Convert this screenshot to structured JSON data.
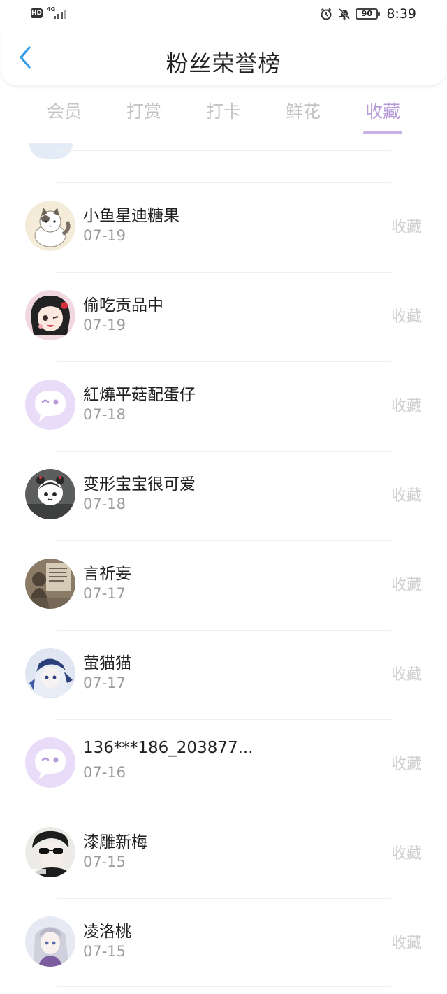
{
  "status_bar": {
    "hd": "HD",
    "network": "4G",
    "battery": "90",
    "time": "8:39"
  },
  "header": {
    "title": "粉丝荣誉榜"
  },
  "tabs": [
    {
      "label": "会员"
    },
    {
      "label": "打赏"
    },
    {
      "label": "打卡"
    },
    {
      "label": "鲜花"
    },
    {
      "label": "收藏"
    }
  ],
  "active_tab": "收藏",
  "accent_color": "#b79ad8",
  "rows": [
    {
      "name": "小鱼星迪糖果",
      "date": "07-19",
      "action": "收藏",
      "avatar": "cat-avatar"
    },
    {
      "name": "偷吃贡品中",
      "date": "07-19",
      "action": "收藏",
      "avatar": "anime-girl-avatar"
    },
    {
      "name": "紅燒平菇配蛋仔",
      "date": "07-18",
      "action": "收藏",
      "avatar": "default-chat-avatar"
    },
    {
      "name": "变形宝宝很可爱",
      "date": "07-18",
      "action": "收藏",
      "avatar": "panda-avatar"
    },
    {
      "name": "言祈妄",
      "date": "07-17",
      "action": "收藏",
      "avatar": "photo-avatar"
    },
    {
      "name": "萤猫猫",
      "date": "07-17",
      "action": "收藏",
      "avatar": "anime-blue-avatar"
    },
    {
      "name": "136***186_203877...",
      "date": "07-16",
      "action": "收藏",
      "avatar": "default-chat-avatar"
    },
    {
      "name": "漆雕新梅",
      "date": "07-15",
      "action": "收藏",
      "avatar": "sunglasses-avatar"
    },
    {
      "name": "凌洛桃",
      "date": "07-15",
      "action": "收藏",
      "avatar": "anime-silver-avatar"
    }
  ]
}
